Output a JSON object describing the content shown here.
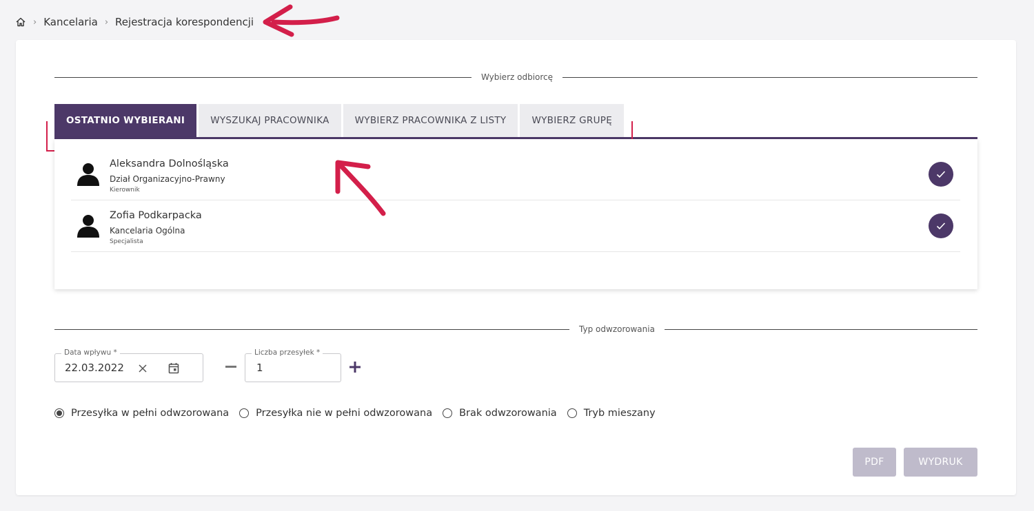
{
  "breadcrumb": {
    "home_icon": "home-icon",
    "items": [
      "Kancelaria",
      "Rejestracja korespondencji"
    ]
  },
  "recipient_section": {
    "label": "Wybierz odbiorcę"
  },
  "tabs": [
    {
      "label": "OSTATNIO WYBIERANI",
      "active": true
    },
    {
      "label": "WYSZUKAJ PRACOWNIKA",
      "active": false
    },
    {
      "label": "WYBIERZ PRACOWNIKA Z LISTY",
      "active": false
    },
    {
      "label": "WYBIERZ GRUPĘ",
      "active": false
    }
  ],
  "recent": [
    {
      "name": "Aleksandra Dolnośląska",
      "department": "Dział Organizacyjno-Prawny",
      "role": "Kierownik"
    },
    {
      "name": "Zofia Podkarpacka",
      "department": "Kancelaria Ogólna",
      "role": "Specjalista"
    }
  ],
  "mapping_section": {
    "label": "Typ odwzorowania"
  },
  "date_field": {
    "label": "Data wpływu *",
    "value": "22.03.2022"
  },
  "count_field": {
    "label": "Liczba przesyłek *",
    "value": "1"
  },
  "radios": [
    {
      "label": "Przesyłka w pełni odwzorowana",
      "checked": true
    },
    {
      "label": "Przesyłka nie w pełni odwzorowana",
      "checked": false
    },
    {
      "label": "Brak odwzorowania",
      "checked": false
    },
    {
      "label": "Tryb mieszany",
      "checked": false
    }
  ],
  "buttons": {
    "pdf": "PDF",
    "print": "WYDRUK"
  },
  "colors": {
    "accent": "#4c3868",
    "annotation": "#d31f4a",
    "disabled_button": "#bfbbcb"
  }
}
